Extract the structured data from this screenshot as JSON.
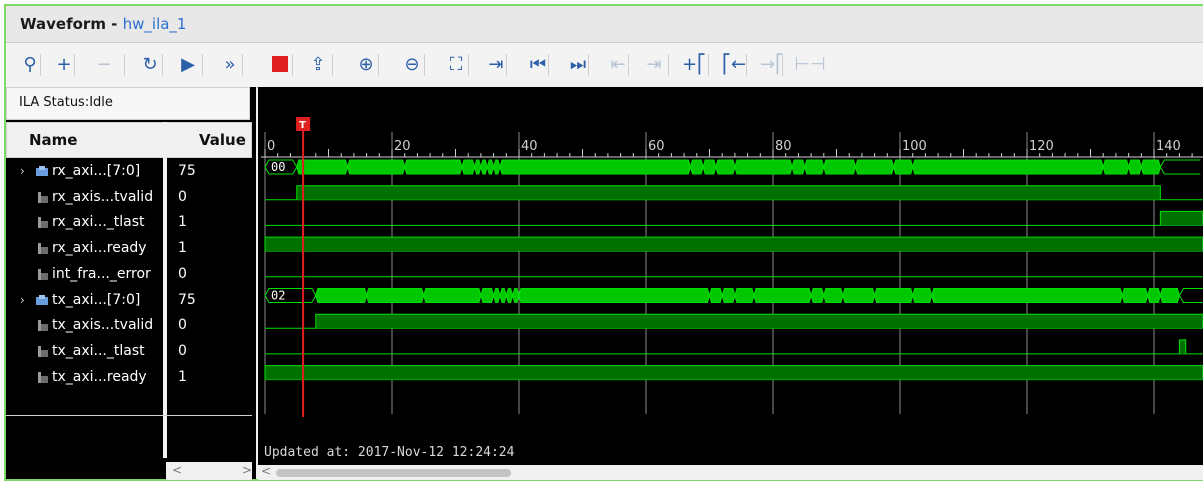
{
  "window": {
    "title": "Waveform",
    "separator": " - ",
    "subtitle": "hw_ila_1"
  },
  "toolbar": {
    "buttons": [
      {
        "icon": "search-icon",
        "glyph": "⚲",
        "enabled": true
      },
      {
        "icon": "plus-icon",
        "glyph": "+",
        "enabled": true
      },
      {
        "icon": "minus-icon",
        "glyph": "−",
        "enabled": false
      },
      {
        "icon": "auto-retrigger-icon",
        "glyph": "↻",
        "enabled": true
      },
      {
        "icon": "run-trigger-icon",
        "glyph": "▶",
        "enabled": true
      },
      {
        "icon": "run-immediate-icon",
        "glyph": "»",
        "enabled": true
      },
      {
        "icon": "stop-icon",
        "glyph": "",
        "enabled": true
      },
      {
        "icon": "export-icon",
        "glyph": "⇪",
        "enabled": true
      },
      {
        "icon": "zoom-in-icon",
        "glyph": "⊕",
        "enabled": true
      },
      {
        "icon": "zoom-out-icon",
        "glyph": "⊖",
        "enabled": true
      },
      {
        "icon": "zoom-fit-icon",
        "glyph": "⛶",
        "enabled": true
      },
      {
        "icon": "go-to-cursor-icon",
        "glyph": "⇥",
        "enabled": true
      },
      {
        "icon": "go-to-start-icon",
        "glyph": "⏮",
        "enabled": true
      },
      {
        "icon": "go-to-end-icon",
        "glyph": "⏭",
        "enabled": true
      },
      {
        "icon": "previous-transition-icon",
        "glyph": "⇤",
        "enabled": false
      },
      {
        "icon": "next-transition-icon",
        "glyph": "⇥",
        "enabled": false
      },
      {
        "icon": "add-marker-icon",
        "glyph": "+⎡",
        "enabled": true
      },
      {
        "icon": "previous-marker-icon",
        "glyph": "⎡←",
        "enabled": true
      },
      {
        "icon": "next-marker-icon",
        "glyph": "→⎡",
        "enabled": false
      },
      {
        "icon": "swap-cursors-icon",
        "glyph": "⊢⊣",
        "enabled": false
      }
    ]
  },
  "ila_status": {
    "label": "ILA Status:",
    "value": "Idle"
  },
  "columns": {
    "name": "Name",
    "value": "Value"
  },
  "signals": [
    {
      "name": "rx_axi...[7:0]",
      "value": "75",
      "bus": true,
      "expandable": true
    },
    {
      "name": "rx_axis...tvalid",
      "value": "0",
      "bus": false
    },
    {
      "name": "rx_axi..._tlast",
      "value": "1",
      "bus": false
    },
    {
      "name": "rx_axi...ready",
      "value": "1",
      "bus": false
    },
    {
      "name": "int_fra..._error",
      "value": "0",
      "bus": false
    },
    {
      "name": "tx_axi...[7:0]",
      "value": "75",
      "bus": true,
      "expandable": true
    },
    {
      "name": "tx_axis...tvalid",
      "value": "0",
      "bus": false
    },
    {
      "name": "tx_axi..._tlast",
      "value": "0",
      "bus": false
    },
    {
      "name": "tx_axi...ready",
      "value": "1",
      "bus": false
    }
  ],
  "timeline": {
    "ticks": [
      "0",
      "20",
      "40",
      "60",
      "80",
      "100",
      "120",
      "140"
    ],
    "trigger_label": "T",
    "trigger_sample": 6
  },
  "bus_start_values": [
    "00",
    "02"
  ],
  "updated": "Updated at: 2017-Nov-12 12:24:24",
  "scroll_left_arrow": "<",
  "scroll_right_arrow": ">",
  "colors": {
    "wave_high": "#00e000",
    "wave_low": "#007000",
    "bus_fill": "#00c800",
    "trigger": "#e02020",
    "grid": "#3a3a3a"
  }
}
